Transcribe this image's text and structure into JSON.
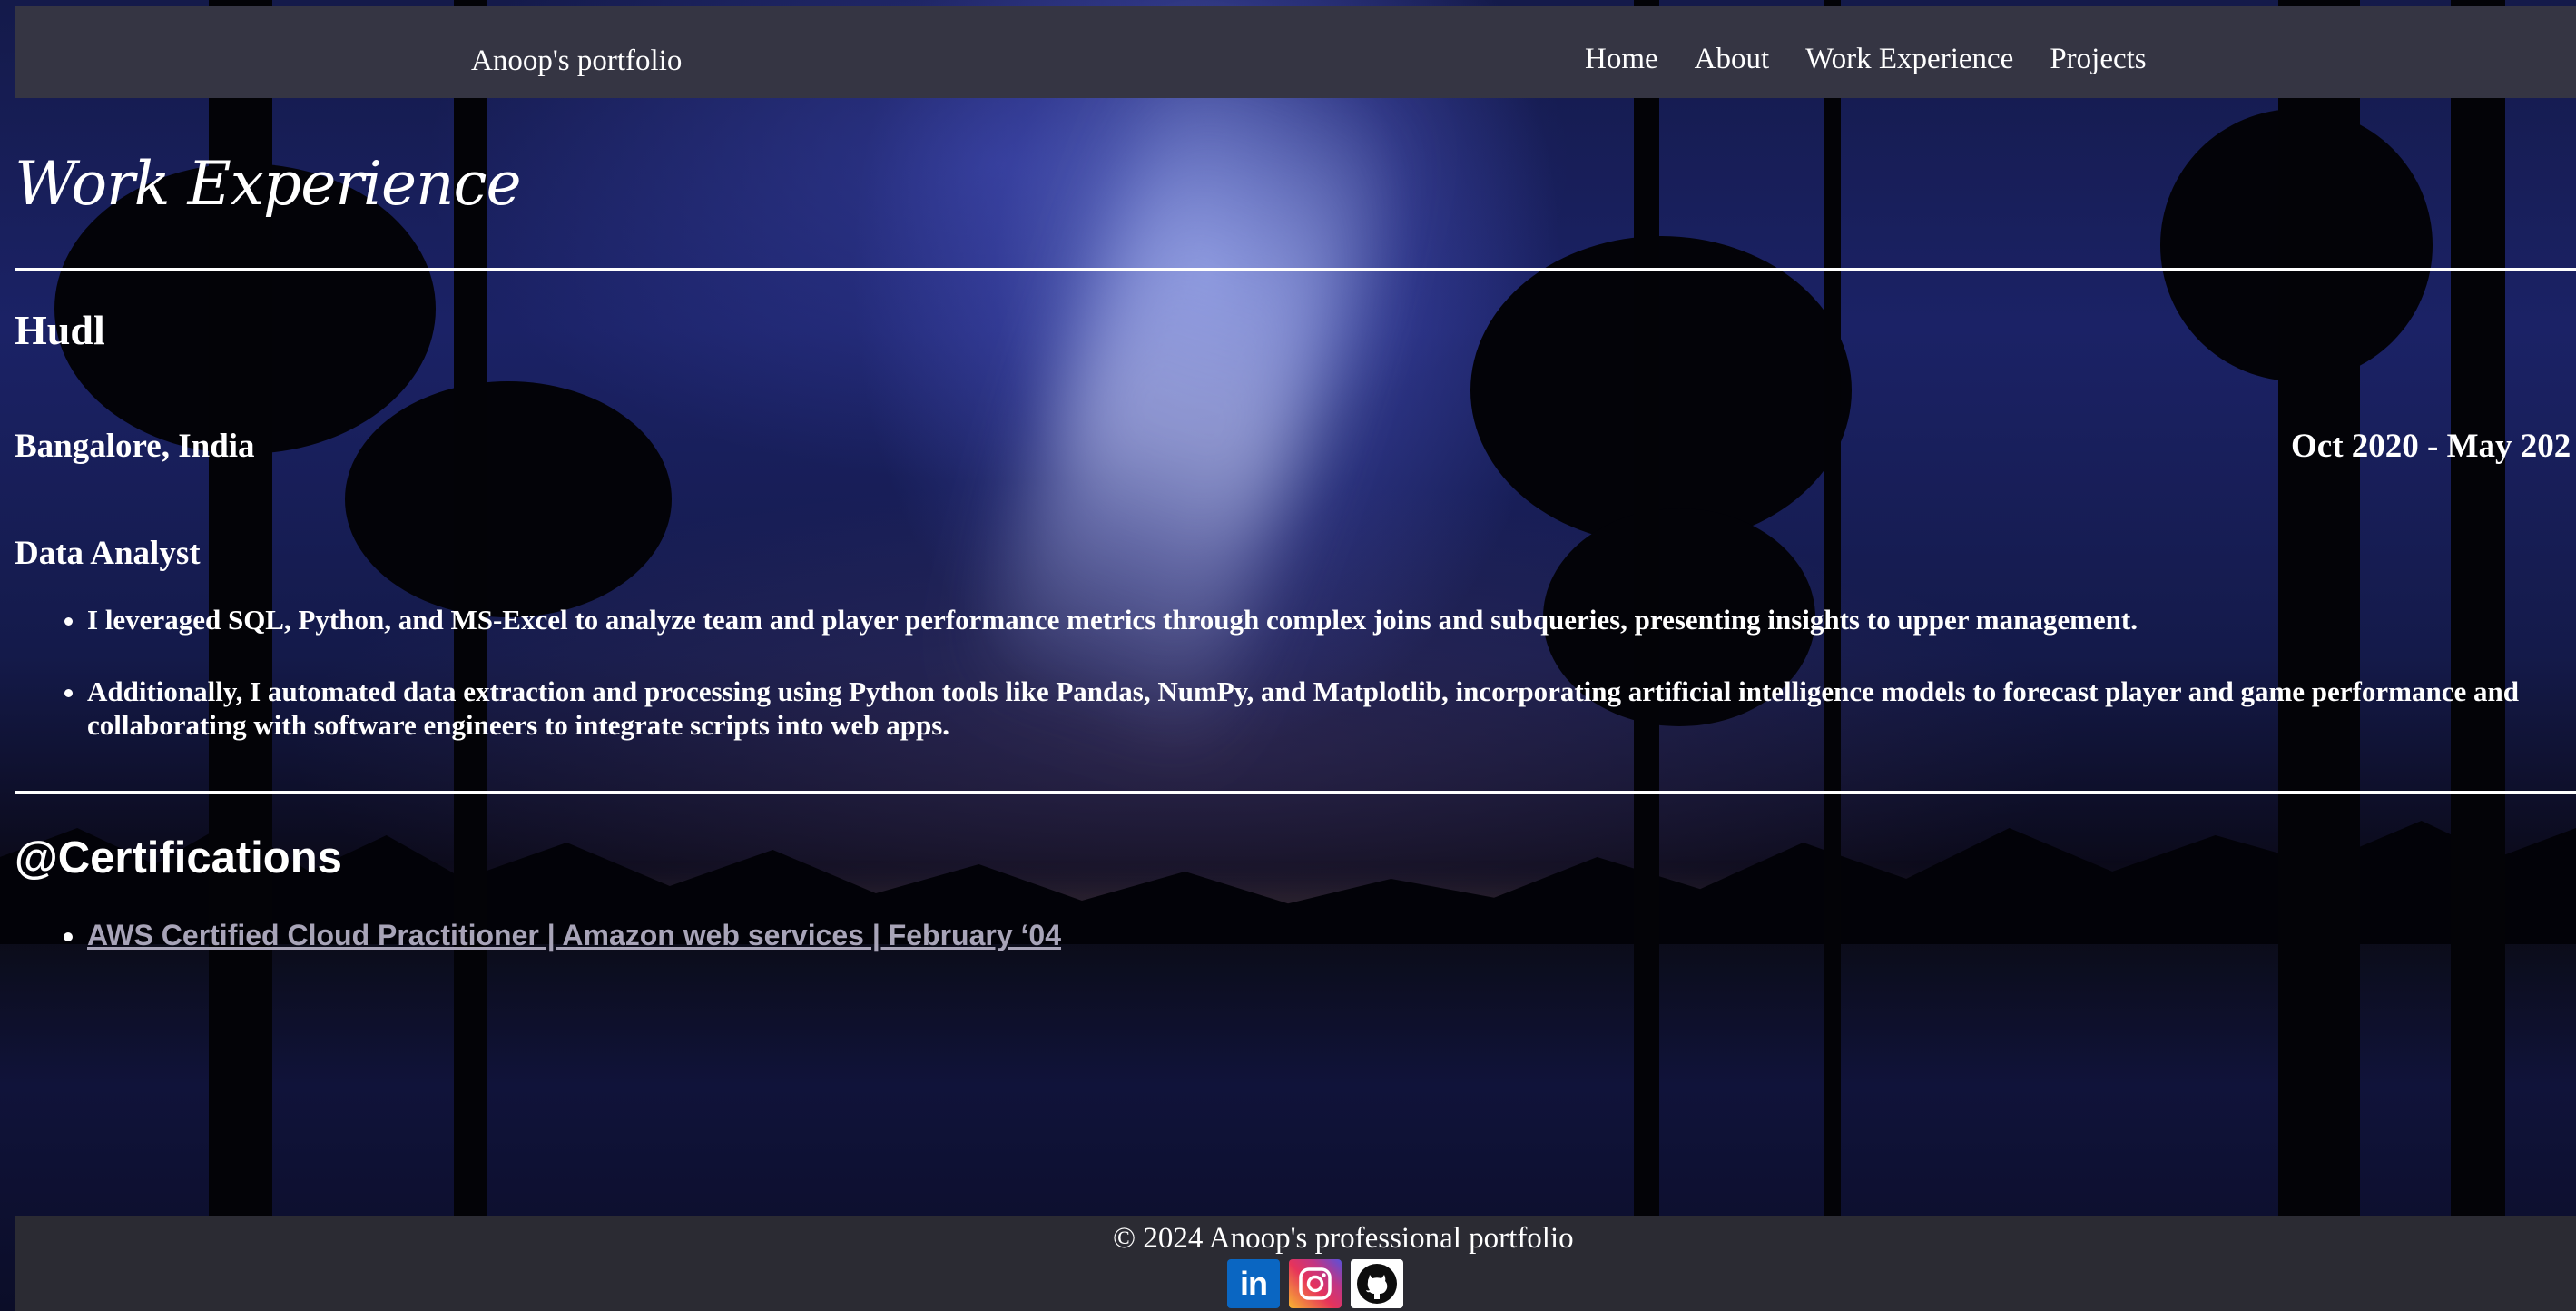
{
  "navbar": {
    "brand": "Anoop's portfolio",
    "links": [
      "Home",
      "About",
      "Work Experience",
      "Projects"
    ]
  },
  "work": {
    "title": "Work Experience",
    "company": "Hudl",
    "location": "Bangalore, India",
    "dates": "Oct 2020 - May 202",
    "role": "Data Analyst",
    "bullets": [
      "I leveraged SQL, Python, and MS-Excel to analyze team and player performance metrics through complex joins and subqueries, presenting insights to upper management.",
      "Additionally, I automated data extraction and processing using Python tools like Pandas, NumPy, and Matplotlib, incorporating artificial intelligence models to forecast player and game performance and collaborating with software engineers to integrate scripts into web apps."
    ]
  },
  "certifications": {
    "title": "@Certifications",
    "items": [
      "AWS Certified Cloud Practitioner | Amazon web services | February ‘04"
    ]
  },
  "footer": {
    "copyright": "© 2024 Anoop's professional portfolio",
    "socials": [
      {
        "name": "linkedin",
        "icon": "linkedin-icon",
        "color": "#0a66c2"
      },
      {
        "name": "instagram",
        "icon": "instagram-icon",
        "color": "#e1306c"
      },
      {
        "name": "github",
        "icon": "github-icon",
        "color": "#000000"
      }
    ]
  },
  "colors": {
    "navbar_bg": "#353543",
    "footer_bg": "#2b2b33",
    "link_muted": "#a8a4b8",
    "text": "#ffffff"
  },
  "background": {
    "icon": "aurora-night-lake-image"
  }
}
